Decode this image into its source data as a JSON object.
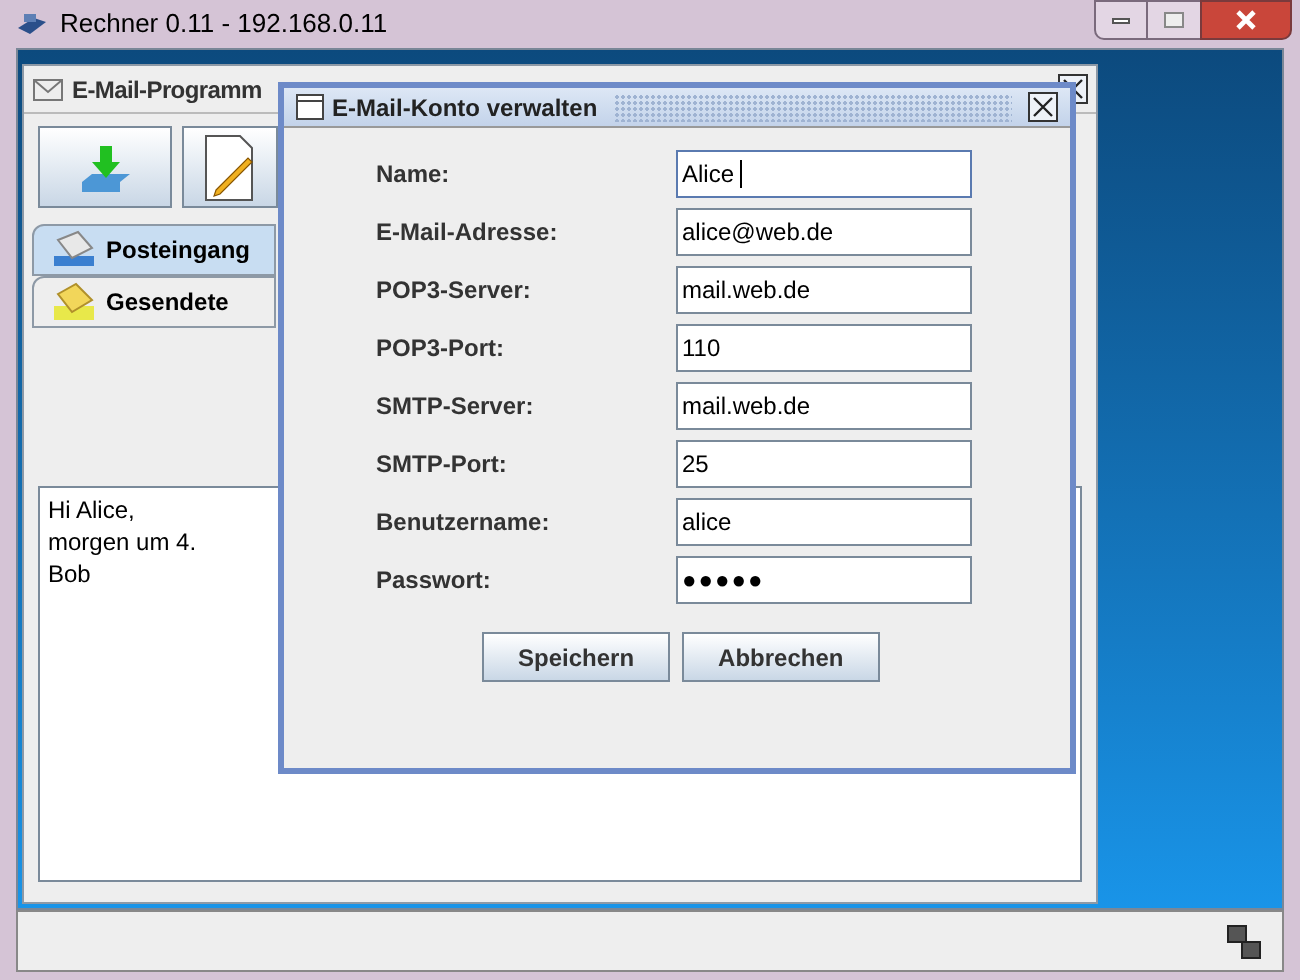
{
  "window": {
    "title": "Rechner 0.11 - 192.168.0.11"
  },
  "mail_frame": {
    "title": "E-Mail-Programm",
    "tabs": [
      {
        "label": "Posteingang",
        "selected": true,
        "kind": "inbox"
      },
      {
        "label": "Gesendete",
        "selected": false,
        "kind": "sent"
      }
    ],
    "message": [
      "Hi Alice,",
      "morgen um 4.",
      "Bob"
    ]
  },
  "dialog": {
    "title": "E-Mail-Konto verwalten",
    "fields": [
      {
        "label": "Name:",
        "value": "Alice",
        "kind": "text",
        "focused": true
      },
      {
        "label": "E-Mail-Adresse:",
        "value": "alice@web.de",
        "kind": "text",
        "focused": false
      },
      {
        "label": "POP3-Server:",
        "value": "mail.web.de",
        "kind": "text",
        "focused": false
      },
      {
        "label": "POP3-Port:",
        "value": "110",
        "kind": "text",
        "focused": false
      },
      {
        "label": "SMTP-Server:",
        "value": "mail.web.de",
        "kind": "text",
        "focused": false
      },
      {
        "label": "SMTP-Port:",
        "value": "25",
        "kind": "text",
        "focused": false
      },
      {
        "label": "Benutzername:",
        "value": "alice",
        "kind": "text",
        "focused": false
      },
      {
        "label": "Passwort:",
        "value": "●●●●●",
        "kind": "password",
        "focused": false
      }
    ],
    "buttons": [
      "Speichern",
      "Abbrechen"
    ]
  }
}
